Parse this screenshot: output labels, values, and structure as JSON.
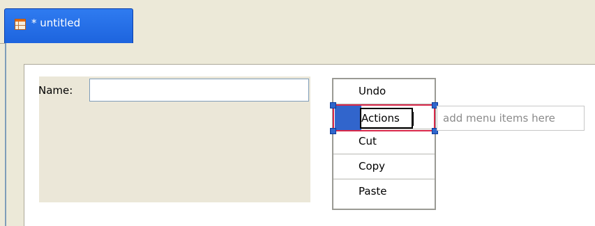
{
  "tab": {
    "title": "* untitled",
    "icon": "form-designer-icon"
  },
  "form": {
    "name_label": "Name:",
    "name_value": "",
    "name_placeholder": ""
  },
  "menu": {
    "items": [
      {
        "label": "Undo"
      },
      {
        "label": "Actions",
        "editing": true
      },
      {
        "label": "Cut"
      },
      {
        "label": "Copy"
      },
      {
        "label": "Paste"
      }
    ],
    "add_hint": "add menu items here"
  },
  "colors": {
    "tab_active": "#1d64de",
    "selection": "#3165cc",
    "selection_outline": "#d8284a",
    "panel": "#ebe7d8"
  }
}
